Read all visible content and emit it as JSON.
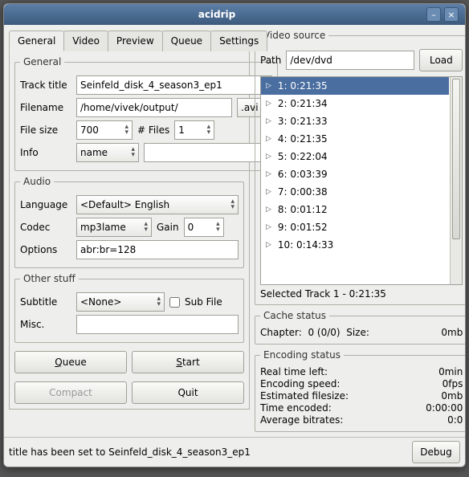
{
  "window": {
    "title": "acidrip"
  },
  "tabs": [
    "General",
    "Video",
    "Preview",
    "Queue",
    "Settings"
  ],
  "general": {
    "legend": "General",
    "track_title_label": "Track title",
    "track_title": "Seinfeld_disk_4_season3_ep1",
    "filename_label": "Filename",
    "filename": "/home/vivek/output/",
    "ext": ".avi",
    "filesize_label": "File size",
    "filesize": "700",
    "numfiles_label": "# Files",
    "numfiles": "1",
    "info_label": "Info",
    "info_sel": "name",
    "info_val": ""
  },
  "audio": {
    "legend": "Audio",
    "language_label": "Language",
    "language": "<Default> English",
    "codec_label": "Codec",
    "codec": "mp3lame",
    "gain_label": "Gain",
    "gain": "0",
    "options_label": "Options",
    "options": "abr:br=128"
  },
  "other": {
    "legend": "Other stuff",
    "subtitle_label": "Subtitle",
    "subtitle": "<None>",
    "subfile_label": "Sub File",
    "misc_label": "Misc.",
    "misc": ""
  },
  "buttons": {
    "queue": "Queue",
    "start": "Start",
    "compact": "Compact",
    "quit": "Quit",
    "load": "Load",
    "debug": "Debug"
  },
  "source": {
    "legend": "Video source",
    "path_label": "Path",
    "path": "/dev/dvd",
    "tracks": [
      "1: 0:21:35",
      "2: 0:21:34",
      "3: 0:21:33",
      "4: 0:21:35",
      "5: 0:22:04",
      "6: 0:03:39",
      "7: 0:00:38",
      "8: 0:01:12",
      "9: 0:01:52",
      "10: 0:14:33"
    ],
    "selected": "Selected Track 1 - 0:21:35"
  },
  "cache": {
    "legend": "Cache status",
    "chapter_label": "Chapter:",
    "chapter": "0 (0/0)",
    "size_label": "Size:",
    "size": "0mb"
  },
  "enc": {
    "legend": "Encoding status",
    "rtl_label": "Real time left:",
    "rtl": "0min",
    "spd_label": "Encoding speed:",
    "spd": "0fps",
    "est_label": "Estimated filesize:",
    "est": "0mb",
    "te_label": "Time encoded:",
    "te": "0:00:00",
    "ab_label": "Average bitrates:",
    "ab": "0:0"
  },
  "status": "title has been set to Seinfeld_disk_4_season3_ep1"
}
